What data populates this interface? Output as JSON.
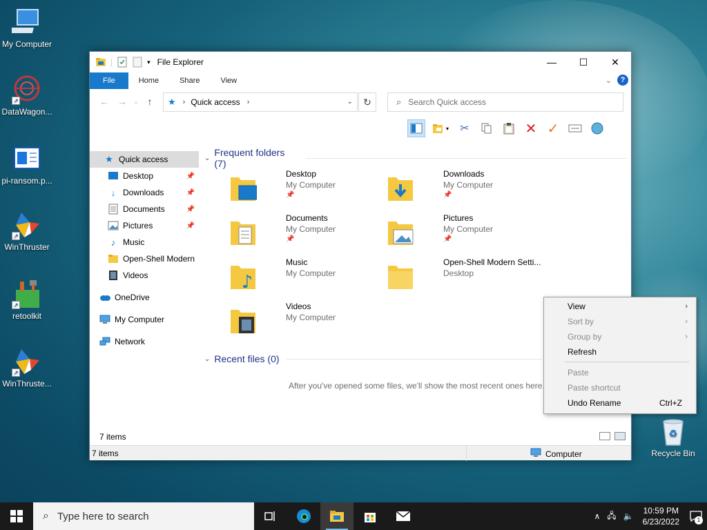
{
  "desktop": {
    "icons": [
      {
        "label": "My Computer",
        "icon": "computer-icon"
      },
      {
        "label": "DataWagon...",
        "icon": "datawagon-icon"
      },
      {
        "label": "pi-ransom.p...",
        "icon": "document-icon"
      },
      {
        "label": "WinThruster",
        "icon": "winthruster-icon"
      },
      {
        "label": "retoolkit",
        "icon": "toolkit-icon"
      },
      {
        "label": "WinThruste...",
        "icon": "winthruster-icon"
      },
      {
        "label": "Recycle Bin",
        "icon": "recycle-bin-icon"
      }
    ]
  },
  "window": {
    "title": "File Explorer",
    "tabs": [
      {
        "label": "File"
      },
      {
        "label": "Home"
      },
      {
        "label": "Share"
      },
      {
        "label": "View"
      }
    ],
    "address": {
      "location": "Quick access"
    },
    "search": {
      "placeholder": "Search Quick access"
    },
    "nav": [
      {
        "label": "Quick access",
        "icon": "star-icon",
        "pinned": false
      },
      {
        "label": "Desktop",
        "icon": "desktop-icon",
        "pinned": true
      },
      {
        "label": "Downloads",
        "icon": "download-icon",
        "pinned": true
      },
      {
        "label": "Documents",
        "icon": "documents-icon",
        "pinned": true
      },
      {
        "label": "Pictures",
        "icon": "pictures-icon",
        "pinned": true
      },
      {
        "label": "Music",
        "icon": "music-icon",
        "pinned": false
      },
      {
        "label": "Open-Shell Modern",
        "icon": "folder-icon",
        "pinned": false
      },
      {
        "label": "Videos",
        "icon": "videos-icon",
        "pinned": false
      },
      {
        "label": "OneDrive",
        "icon": "onedrive-icon",
        "pinned": false
      },
      {
        "label": "My Computer",
        "icon": "computer-icon",
        "pinned": false
      },
      {
        "label": "Network",
        "icon": "network-icon",
        "pinned": false
      }
    ],
    "frequent_header": "Frequent folders (7)",
    "folders": [
      {
        "name": "Desktop",
        "location": "My Computer",
        "pinned": true,
        "icon": "desktop-folder-icon"
      },
      {
        "name": "Downloads",
        "location": "My Computer",
        "pinned": true,
        "icon": "downloads-folder-icon"
      },
      {
        "name": "Documents",
        "location": "My Computer",
        "pinned": true,
        "icon": "documents-folder-icon"
      },
      {
        "name": "Pictures",
        "location": "My Computer",
        "pinned": true,
        "icon": "pictures-folder-icon"
      },
      {
        "name": "Music",
        "location": "My Computer",
        "pinned": false,
        "icon": "music-folder-icon"
      },
      {
        "name": "Open-Shell Modern Setti...",
        "location": "Desktop",
        "pinned": false,
        "icon": "folder-icon"
      },
      {
        "name": "Videos",
        "location": "My Computer",
        "pinned": false,
        "icon": "videos-folder-icon"
      }
    ],
    "recent_header": "Recent files (0)",
    "recent_empty": "After you've opened some files, we'll show the most recent ones here.",
    "status_count": "7 items",
    "statusbar": {
      "items": "7 items",
      "location": "Computer"
    }
  },
  "context_menu": {
    "items": [
      {
        "label": "View",
        "disabled": false,
        "submenu": true
      },
      {
        "label": "Sort by",
        "disabled": true,
        "submenu": true
      },
      {
        "label": "Group by",
        "disabled": true,
        "submenu": true
      },
      {
        "label": "Refresh",
        "disabled": false,
        "submenu": false
      }
    ],
    "items2": [
      {
        "label": "Paste",
        "disabled": true,
        "shortcut": ""
      },
      {
        "label": "Paste shortcut",
        "disabled": true,
        "shortcut": ""
      },
      {
        "label": "Undo Rename",
        "disabled": false,
        "shortcut": "Ctrl+Z"
      }
    ]
  },
  "taskbar": {
    "search_placeholder": "Type here to search",
    "time": "10:59 PM",
    "date": "6/23/2022",
    "notification_count": "1"
  },
  "colors": {
    "accent": "#1979ca",
    "header_blue": "#1e3287",
    "folder_yellow": "#f5c842"
  }
}
